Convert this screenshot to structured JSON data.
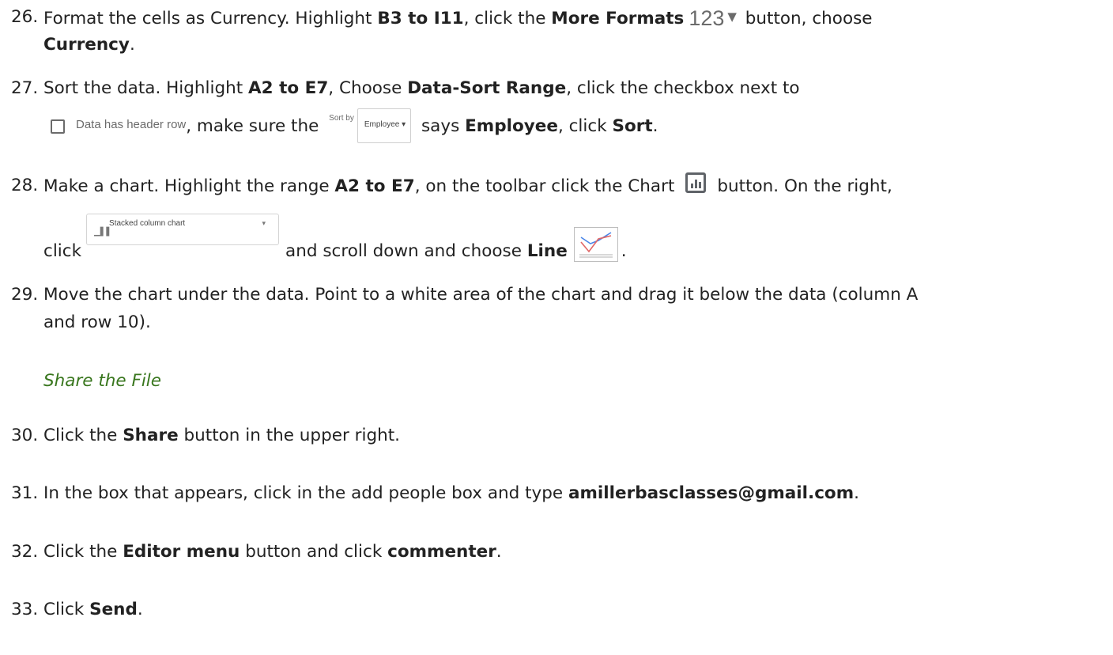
{
  "items": [
    {
      "num": "26.",
      "s1": "Format the cells as Currency. Highlight ",
      "b1": "B3 to I11",
      "s2": ", click the ",
      "b2": "More Formats",
      "icon_num": "123",
      "s3": " button, choose",
      "b3": "Currency",
      "s4": "."
    },
    {
      "num": "27.",
      "s1": "Sort the data. Highlight ",
      "b1": "A2 to E7",
      "s2": ", Choose ",
      "b2": "Data-Sort Range",
      "s3": ", click the checkbox next to",
      "checkbox_label": "Data has header row",
      "s4": ", make sure the ",
      "sortby_label": "Sort by",
      "sortby_value": "Employee",
      "s5": " says ",
      "b3": "Employee",
      "s6": ", click ",
      "b4": "Sort",
      "s7": "."
    },
    {
      "num": "28.",
      "s1": "Make a chart. Highlight the range ",
      "b1": "A2 to E7",
      "s2": ", on the toolbar click the Chart",
      "s3": "button. On the right,",
      "s4": "click",
      "dropdown_label": "Stacked column chart",
      "s5": "and scroll down and choose ",
      "b2": "Line",
      "s6": "."
    },
    {
      "num": "29.",
      "line1": "Move the chart under the data. Point to a white area of the chart and drag it below the data (column A",
      "line2": "and row 10)."
    }
  ],
  "heading": "Share the File",
  "steps": [
    {
      "num": "30.",
      "s1": "Click the ",
      "b1": "Share",
      "s2": " button in the upper right."
    },
    {
      "num": "31.",
      "s1": "In the box that appears, click in the add people box and type ",
      "b1": "amillerbasclasses@gmail.com",
      "s2": "."
    },
    {
      "num": "32.",
      "s1": "Click the ",
      "b1": "Editor menu",
      "s2": " button and click ",
      "b2": "commenter",
      "s3": "."
    },
    {
      "num": "33.",
      "s1": "Click ",
      "b1": "Send",
      "s2": "."
    }
  ],
  "colors": {
    "heading": "#38761d",
    "icon_gray": "#5f6368",
    "line_blue": "#4a86e8",
    "line_red": "#e06666"
  },
  "icons": [
    "dropdown-triangle-icon",
    "checkbox-icon",
    "chart-bar-icon",
    "column-chart-icon",
    "line-chart-icon"
  ]
}
